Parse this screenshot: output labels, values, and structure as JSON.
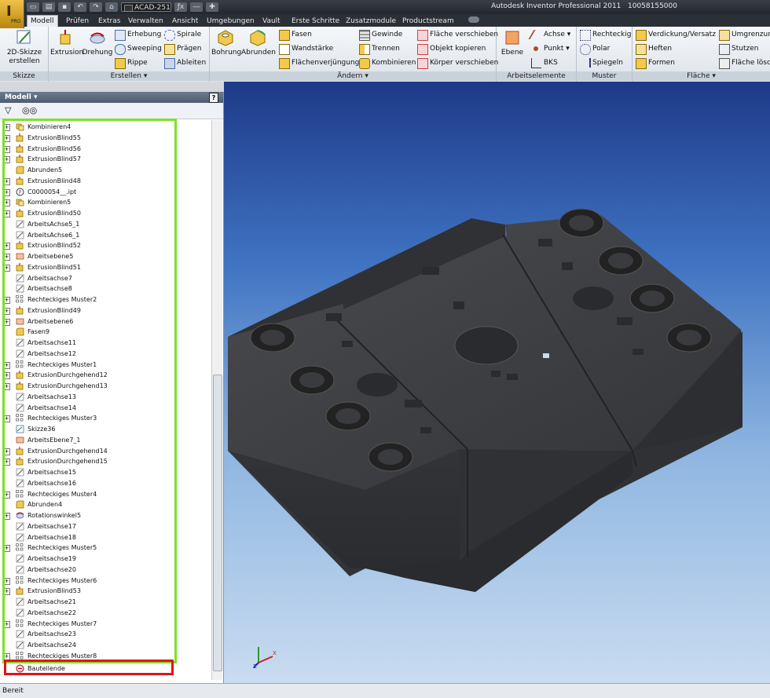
{
  "titlebar": {
    "title": "Autodesk Inventor Professional 2011",
    "serial": "10058155000",
    "style_combo": "ACAD-251",
    "app_badge": "PRO"
  },
  "tabs": [
    "Modell",
    "Prüfen",
    "Extras",
    "Verwalten",
    "Ansicht",
    "Umgebungen",
    "Vault",
    "Erste Schritte",
    "Zusatzmodule",
    "Productstream"
  ],
  "active_tab": "Modell",
  "ribbon": {
    "skizze": {
      "btn": "2D-Skizze erstellen",
      "label": "Skizze"
    },
    "erstellen": {
      "extrusion": "Extrusion",
      "drehung": "Drehung",
      "erhebung": "Erhebung",
      "sweeping": "Sweeping",
      "rippe": "Rippe",
      "spirale": "Spirale",
      "praegen": "Prägen",
      "ableiten": "Ableiten",
      "label": "Erstellen"
    },
    "aendern": {
      "bohrung": "Bohrung",
      "abrunden": "Abrunden",
      "fasen": "Fasen",
      "wandstaerke": "Wandstärke",
      "flaechenverj": "Flächenverjüngung",
      "gewinde": "Gewinde",
      "trennen": "Trennen",
      "kombinieren": "Kombinieren",
      "flaeche_versch": "Fläche verschieben",
      "objekt_kop": "Objekt kopieren",
      "koerper_versch": "Körper verschieben",
      "label": "Ändern"
    },
    "arbeitselemente": {
      "ebene": "Ebene",
      "achse": "Achse",
      "punkt": "Punkt",
      "bks": "BKS",
      "label": "Arbeitselemente"
    },
    "muster": {
      "rechteckig": "Rechteckig",
      "polar": "Polar",
      "spiegeln": "Spiegeln",
      "label": "Muster"
    },
    "flaeche": {
      "verdickung": "Verdickung/Versatz",
      "heften": "Heften",
      "formen": "Formen",
      "umgrenzung": "Umgrenzung",
      "stutzen": "Stutzen",
      "flaeche_loeschen": "Fläche lösch",
      "label": "Fläche"
    }
  },
  "browser": {
    "title": "Modell",
    "help": "?",
    "end_item": "Bauteilende",
    "items": [
      {
        "t": "Kombinieren4",
        "i": "comb",
        "p": true
      },
      {
        "t": "ExtrusionBlind55",
        "i": "ext",
        "p": true
      },
      {
        "t": "ExtrusionBlind56",
        "i": "ext",
        "p": true
      },
      {
        "t": "ExtrusionBlind57",
        "i": "ext",
        "p": true
      },
      {
        "t": "Abrunden5",
        "i": "fil",
        "p": false
      },
      {
        "t": "ExtrusionBlind48",
        "i": "ext",
        "p": true
      },
      {
        "t": "C0000054__.ipt",
        "i": "ipt",
        "p": true
      },
      {
        "t": "Kombinieren5",
        "i": "comb",
        "p": true
      },
      {
        "t": "ExtrusionBlind50",
        "i": "ext",
        "p": true
      },
      {
        "t": "ArbeitsAchse5_1",
        "i": "ax",
        "p": false
      },
      {
        "t": "ArbeitsAchse6_1",
        "i": "ax",
        "p": false
      },
      {
        "t": "ExtrusionBlind52",
        "i": "ext",
        "p": true
      },
      {
        "t": "Arbeitsebene5",
        "i": "pl",
        "p": true
      },
      {
        "t": "ExtrusionBlind51",
        "i": "ext",
        "p": true
      },
      {
        "t": "Arbeitsachse7",
        "i": "ax",
        "p": false
      },
      {
        "t": "Arbeitsachse8",
        "i": "ax",
        "p": false
      },
      {
        "t": "Rechteckiges Muster2",
        "i": "pat",
        "p": true
      },
      {
        "t": "ExtrusionBlind49",
        "i": "ext",
        "p": true
      },
      {
        "t": "Arbeitsebene6",
        "i": "pl",
        "p": true
      },
      {
        "t": "Fasen9",
        "i": "fil",
        "p": false
      },
      {
        "t": "Arbeitsachse11",
        "i": "ax",
        "p": false
      },
      {
        "t": "Arbeitsachse12",
        "i": "ax",
        "p": false
      },
      {
        "t": "Rechteckiges Muster1",
        "i": "pat",
        "p": true
      },
      {
        "t": "ExtrusionDurchgehend12",
        "i": "ext",
        "p": true
      },
      {
        "t": "ExtrusionDurchgehend13",
        "i": "ext",
        "p": true
      },
      {
        "t": "Arbeitsachse13",
        "i": "ax",
        "p": false
      },
      {
        "t": "Arbeitsachse14",
        "i": "ax",
        "p": false
      },
      {
        "t": "Rechteckiges Muster3",
        "i": "pat",
        "p": true
      },
      {
        "t": "Skizze36",
        "i": "sk",
        "p": false
      },
      {
        "t": "ArbeitsEbene7_1",
        "i": "pl",
        "p": false
      },
      {
        "t": "ExtrusionDurchgehend14",
        "i": "ext",
        "p": true
      },
      {
        "t": "ExtrusionDurchgehend15",
        "i": "ext",
        "p": true
      },
      {
        "t": "Arbeitsachse15",
        "i": "ax",
        "p": false
      },
      {
        "t": "Arbeitsachse16",
        "i": "ax",
        "p": false
      },
      {
        "t": "Rechteckiges Muster4",
        "i": "pat",
        "p": true
      },
      {
        "t": "Abrunden4",
        "i": "fil",
        "p": false
      },
      {
        "t": "Rotationswinkel5",
        "i": "rev",
        "p": true
      },
      {
        "t": "Arbeitsachse17",
        "i": "ax",
        "p": false
      },
      {
        "t": "Arbeitsachse18",
        "i": "ax",
        "p": false
      },
      {
        "t": "Rechteckiges Muster5",
        "i": "pat",
        "p": true
      },
      {
        "t": "Arbeitsachse19",
        "i": "ax",
        "p": false
      },
      {
        "t": "Arbeitsachse20",
        "i": "ax",
        "p": false
      },
      {
        "t": "Rechteckiges Muster6",
        "i": "pat",
        "p": true
      },
      {
        "t": "ExtrusionBlind53",
        "i": "ext",
        "p": true
      },
      {
        "t": "Arbeitsachse21",
        "i": "ax",
        "p": false
      },
      {
        "t": "Arbeitsachse22",
        "i": "ax",
        "p": false
      },
      {
        "t": "Rechteckiges Muster7",
        "i": "pat",
        "p": true
      },
      {
        "t": "Arbeitsachse23",
        "i": "ax",
        "p": false
      },
      {
        "t": "Arbeitsachse24",
        "i": "ax",
        "p": false
      },
      {
        "t": "Rechteckiges Muster8",
        "i": "pat",
        "p": true
      }
    ]
  },
  "status": {
    "text": "Bereit"
  },
  "colors": {
    "highlight_green": "#7de02a",
    "highlight_red": "#e0131a",
    "part": "#3a3b3e"
  }
}
